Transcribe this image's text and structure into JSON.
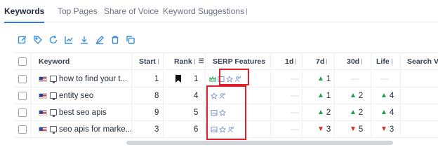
{
  "tabs": [
    {
      "label": "Keywords",
      "active": true
    },
    {
      "label": "Top Pages",
      "active": false
    },
    {
      "label": "Share of Voice",
      "active": false
    },
    {
      "label": "Keyword Suggestions",
      "active": false
    }
  ],
  "toolbar": {
    "icons": [
      "edit-icon",
      "tag-icon",
      "refresh-icon",
      "chart-icon",
      "download-icon",
      "pencil-icon",
      "trash-icon",
      "copy-icon"
    ]
  },
  "table": {
    "columns": {
      "keyword": "Keyword",
      "start": "Start",
      "rank": "Rank",
      "serp": "SERP Features",
      "d1": "1d",
      "d7": "7d",
      "d30": "30d",
      "life": "Life",
      "search_vol": "Search Vol"
    },
    "rows": [
      {
        "keyword": "how to find your t...",
        "start": "1",
        "rank": "1",
        "bookmark": true,
        "d1": "—",
        "d7": "1",
        "d7_dir": "up",
        "d30": "—",
        "life": "—"
      },
      {
        "keyword": "entity seo",
        "start": "8",
        "rank": "4",
        "bookmark": false,
        "d1": "—",
        "d7": "1",
        "d7_dir": "up",
        "d30": "2",
        "d30_dir": "up",
        "life": "4",
        "life_dir": "up"
      },
      {
        "keyword": "best seo apis",
        "start": "9",
        "rank": "5",
        "bookmark": false,
        "d1": "—",
        "d7": "2",
        "d7_dir": "up",
        "d30": "2",
        "d30_dir": "up",
        "life": "4",
        "life_dir": "up"
      },
      {
        "keyword": "seo apis for marke...",
        "start": "3",
        "rank": "6",
        "bookmark": false,
        "d1": "—",
        "d7": "3",
        "d7_dir": "down",
        "d30": "5",
        "d30_dir": "down",
        "life": "3",
        "life_dir": "down"
      }
    ]
  },
  "colors": {
    "accent": "#2a7ae2",
    "toolbar_icon": "#3b8fd8",
    "up": "#16a34a",
    "down": "#dc2626",
    "highlight": "#e11d2e"
  }
}
